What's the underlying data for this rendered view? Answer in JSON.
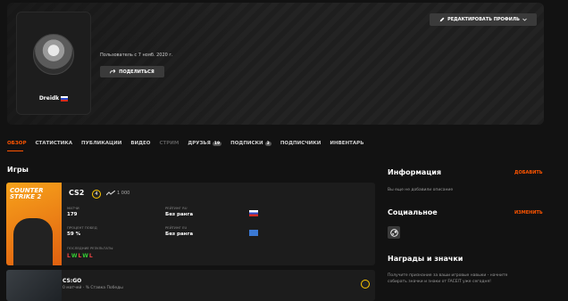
{
  "profile": {
    "nickname": "Dreidk",
    "member_since": "Пользователь с 7 нояб. 2020 г.",
    "share_label": "ПОДЕЛИТЬСЯ",
    "edit_label": "РЕДАКТИРОВАТЬ ПРОФИЛЬ"
  },
  "tabs": [
    {
      "label": "ОБЗОР",
      "state": "active"
    },
    {
      "label": "СТАТИСТИКА",
      "state": "normal"
    },
    {
      "label": "ПУБЛИКАЦИИ",
      "state": "normal"
    },
    {
      "label": "ВИДЕО",
      "state": "normal"
    },
    {
      "label": "СТРИМ",
      "state": "disabled"
    },
    {
      "label": "ДРУЗЬЯ",
      "state": "normal",
      "badge": "19"
    },
    {
      "label": "ПОДПИСКИ",
      "state": "normal",
      "badge": "3"
    },
    {
      "label": "ПОДПИСЧИКИ",
      "state": "normal"
    },
    {
      "label": "ИНВЕНТАРЬ",
      "state": "normal"
    }
  ],
  "games": {
    "title": "Игры",
    "cs2": {
      "art_text_line1": "COUNTER",
      "art_text_line2": "STRIKE 2",
      "name": "CS2",
      "level": "4",
      "elo": "1 000",
      "matches_label": "МАТЧИ",
      "matches_value": "179",
      "winrate_label": "ПРОЦЕНТ ПОБЕД",
      "winrate_value": "59 %",
      "rating_eu_label": "РЕЙТИНГ RU",
      "rating_eu_value": "Без ранга",
      "rating_na_label": "РЕЙТИНГ EU",
      "rating_na_value": "Без ранга",
      "recent_label": "ПОСЛЕДНИЕ РЕЗУЛЬТАТЫ",
      "recent_results": [
        "L",
        "W",
        "L",
        "W",
        "L"
      ]
    },
    "csgo": {
      "name": "CS:GO",
      "subtitle": "0 матчей · % Ставка Победы"
    }
  },
  "info": {
    "title": "Информация",
    "add_label": "ДОБАВИТЬ",
    "empty_text": "Вы еще не добавили описание"
  },
  "social": {
    "title": "Социальное",
    "edit_label": "ИЗМЕНИТЬ"
  },
  "awards": {
    "title": "Награды и значки",
    "text_line1": "Получите признание за ваши игровые навыки - начните",
    "text_line2": "собирать значки и знаки от FACEIT уже сегодня!"
  },
  "colors": {
    "accent": "#ff5500",
    "level": "#ffc800",
    "win": "#33cc33",
    "loss": "#ee4444"
  }
}
